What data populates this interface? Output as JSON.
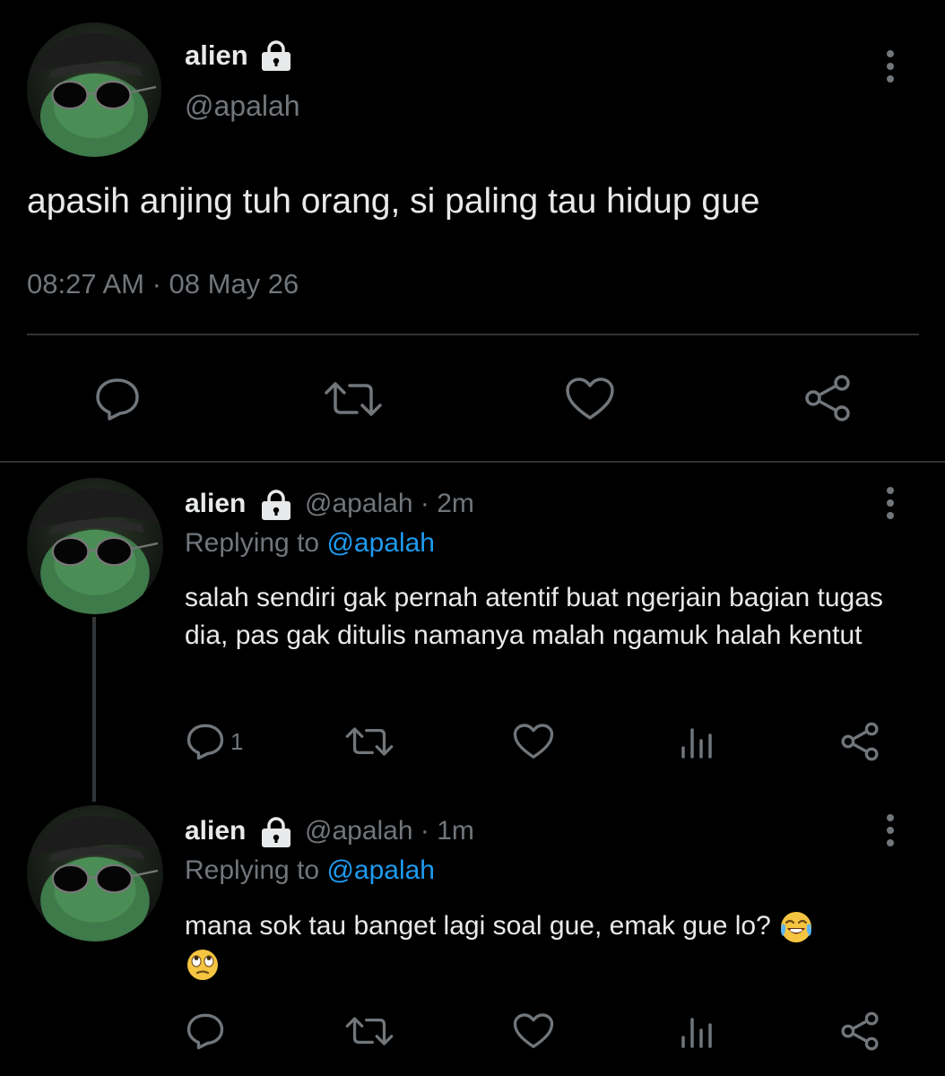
{
  "main_tweet": {
    "display_name": "alien",
    "handle": "@apalah",
    "text": "apasih anjing tuh orang, si paling tau hidup gue",
    "timestamp": "08:27 AM · 08 May 26"
  },
  "replies": [
    {
      "display_name": "alien",
      "handle_time": "@apalah · 2m",
      "replying_prefix": "Replying to ",
      "replying_to": "@apalah",
      "text": "salah sendiri gak pernah atentif buat ngerjain bagian tugas dia, pas gak ditulis namanya malah ngamuk halah kentut",
      "reply_count": "1"
    },
    {
      "display_name": "alien",
      "handle_time": "@apalah · 1m",
      "replying_prefix": "Replying to ",
      "replying_to": "@apalah",
      "text": "mana sok tau banget lagi soal gue, emak gue lo?",
      "emojis": [
        "face-with-tears-of-joy",
        "face-with-rolling-eyes"
      ],
      "reply_count": ""
    }
  ],
  "colors": {
    "background": "#000000",
    "text_primary": "#e7e9ea",
    "text_secondary": "#71767b",
    "link": "#1d9bf0",
    "divider": "#2f3336"
  },
  "icons": [
    "lock-icon",
    "more-icon",
    "reply-icon",
    "retweet-icon",
    "like-icon",
    "views-icon",
    "share-icon"
  ]
}
